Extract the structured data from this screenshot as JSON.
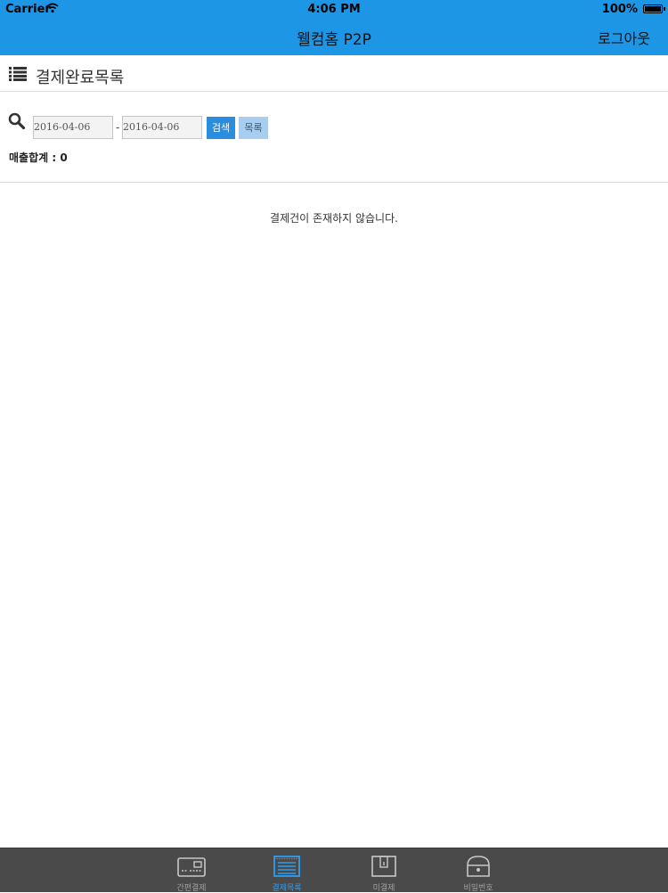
{
  "status_bar": {
    "carrier": "Carrier",
    "time": "4:06 PM",
    "battery": "100%"
  },
  "nav": {
    "title": "웰컴홈 P2P",
    "logout_label": "로그아웃"
  },
  "page": {
    "title": "결제완료목록",
    "title_icon": "list-icon"
  },
  "search": {
    "icon": "search-icon",
    "start_date": "2016-04-06",
    "end_date": "2016-04-06",
    "separator": "-",
    "search_button": "검색",
    "list_button": "목록"
  },
  "summary": {
    "sales_total": "매출합계 : 0"
  },
  "empty_message": "결제건이 존재하지 않습니다.",
  "tabs": [
    {
      "label": "간편결제",
      "icon": "card-terminal-icon",
      "active": false
    },
    {
      "label": "결제목록",
      "icon": "receipt-list-icon",
      "active": true
    },
    {
      "label": "미결제",
      "icon": "document-icon",
      "active": false
    },
    {
      "label": "비밀번호",
      "icon": "lock-icon",
      "active": false
    }
  ],
  "colors": {
    "nav_background": "#1e96e6",
    "search_button": "#2a8ddd",
    "list_button": "#a9cdee",
    "tabbar_background": "#4a4a4a",
    "active_tab": "#2d9cf0"
  }
}
